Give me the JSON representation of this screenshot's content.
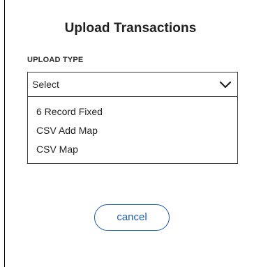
{
  "dialog": {
    "title": "Upload Transactions",
    "upload_type_label": "UPLOAD TYPE",
    "select_value": "Select",
    "options": [
      {
        "label": "6 Record Fixed"
      },
      {
        "label": "CSV Add Map"
      },
      {
        "label": "CSV Map"
      }
    ],
    "cancel_label": "cancel"
  },
  "colors": {
    "accent": "#1d5fa8",
    "border": "#3b3b3b",
    "text": "#212121",
    "background": "#ffffff"
  },
  "icons": {
    "select_chevron": "chevron-down-icon"
  }
}
